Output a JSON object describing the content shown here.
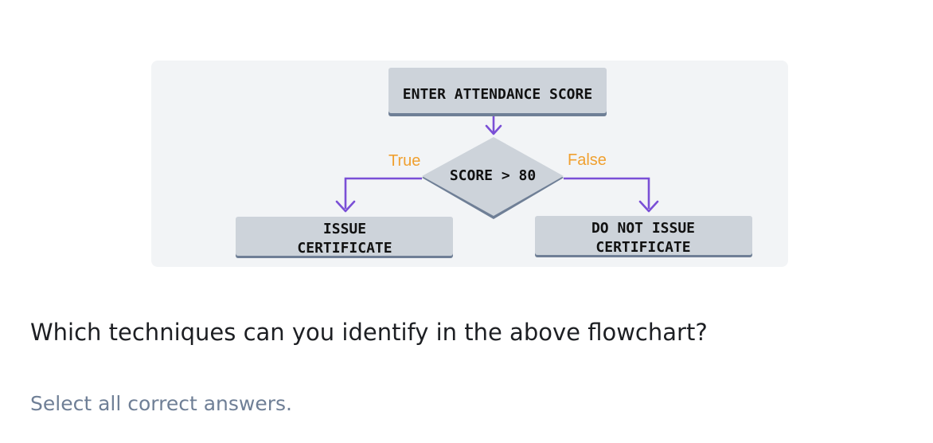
{
  "flowchart": {
    "start_box": "ENTER ATTENDANCE SCORE",
    "decision": "SCORE > 80",
    "true_label": "True",
    "false_label": "False",
    "true_box_line1": "ISSUE",
    "true_box_line2": "CERTIFICATE",
    "false_box_line1": "DO NOT ISSUE",
    "false_box_line2": "CERTIFICATE"
  },
  "question": {
    "text": "Which techniques can you identify in the above flowchart?",
    "instruction": "Select all correct answers."
  },
  "colors": {
    "box_fill": "#cdd3da",
    "box_shadow": "#6f7f96",
    "arrow": "#7a4fd6",
    "branch_label": "#f0a030"
  }
}
